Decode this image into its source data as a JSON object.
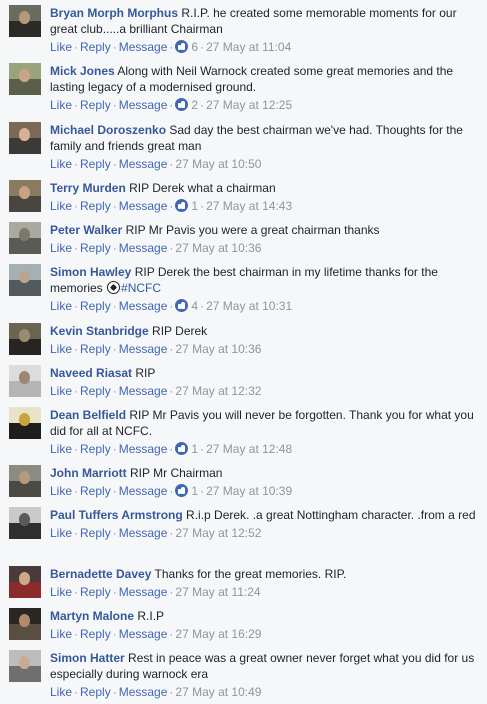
{
  "actions": {
    "like": "Like",
    "reply": "Reply",
    "message": "Message",
    "dot": "·"
  },
  "comments": [
    {
      "author": "Bryan Morph Morphus",
      "text": "R.I.P. he created some memorable moments for our great club.....a brilliant Chairman",
      "likes": "6",
      "time": "27 May at 11:04",
      "avatar_colors": [
        "#6b6b5e",
        "#2b2a24",
        "#b39a7c"
      ]
    },
    {
      "author": "Mick Jones",
      "text": "Along with Neil Warnock created some great memories and the lasting legacy of a modernised ground.",
      "likes": "2",
      "time": "27 May at 12:25",
      "avatar_colors": [
        "#9aa37a",
        "#5b5f4a",
        "#c9a488"
      ]
    },
    {
      "author": "Michael Doroszenko",
      "text": "Sad day the best chairman we've had. Thoughts for the family and friends great man",
      "likes": "",
      "time": "27 May at 10:50",
      "avatar_colors": [
        "#7a6a55",
        "#3b3a36",
        "#d6b193"
      ]
    },
    {
      "author": "Terry Murden",
      "text": "RIP Derek what a chairman",
      "likes": "1",
      "time": "27 May at 14:43",
      "avatar_colors": [
        "#8a7a62",
        "#4a463f",
        "#c7a383"
      ]
    },
    {
      "author": "Peter Walker",
      "text": "RIP Mr Pavis you were a great chairman thanks",
      "likes": "",
      "time": "27 May at 10:36",
      "avatar_colors": [
        "#a9a9a2",
        "#5c5a54",
        "#7d7869"
      ]
    },
    {
      "author": "Simon Hawley",
      "text": "RIP Derek the best chairman in my lifetime thanks for the memories",
      "hashtag": "#NCFC",
      "likes": "4",
      "time": "27 May at 10:31",
      "avatar_colors": [
        "#a4b0b5",
        "#53595c",
        "#b9a58e"
      ]
    },
    {
      "author": "Kevin Stanbridge",
      "text": "RIP Derek",
      "likes": "",
      "time": "27 May at 10:36",
      "avatar_colors": [
        "#6b6450",
        "#262523",
        "#9a8c70"
      ]
    },
    {
      "author": "Naveed Riasat",
      "text": "RIP",
      "likes": "",
      "time": "27 May at 12:32",
      "avatar_colors": [
        "#dcdcdc",
        "#b5b5b5",
        "#9e8672"
      ]
    },
    {
      "author": "Dean Belfield",
      "text": "RIP Mr Pavis you will never be forgotten. Thank you for what you did for all at NCFC.",
      "likes": "1",
      "time": "27 May at 12:48",
      "avatar_colors": [
        "#e8e2c8",
        "#1e1e1e",
        "#c8a43a"
      ]
    },
    {
      "author": "John Marriott",
      "text": "RIP Mr Chairman",
      "likes": "1",
      "time": "27 May at 10:39",
      "avatar_colors": [
        "#8c8b80",
        "#4b4a44",
        "#b69a80"
      ]
    },
    {
      "author": "Paul Tuffers Armstrong",
      "text": "R.i.p Derek. .a great Nottingham character. .from a red",
      "likes": "",
      "time": "27 May at 12:52",
      "avatar_colors": [
        "#c9c9c9",
        "#2f2f2f",
        "#5a5a5a"
      ]
    },
    {
      "author": "Bernadette Davey",
      "text": "Thanks for the great memories. RIP.",
      "likes": "",
      "time": "27 May at 11:24",
      "avatar_colors": [
        "#4a3b3a",
        "#8c2b2b",
        "#cfa98c"
      ]
    },
    {
      "author": "Martyn Malone",
      "text": "R.I.P",
      "likes": "",
      "time": "27 May at 16:29",
      "avatar_colors": [
        "#2a2622",
        "#5a4e40",
        "#b08a6a"
      ]
    },
    {
      "author": "Simon Hatter",
      "text": "Rest in peace was a great owner never forget what you did for us especially during warnock era",
      "likes": "",
      "time": "27 May at 10:49",
      "avatar_colors": [
        "#bdbdbd",
        "#6f6f6f",
        "#c9ab93"
      ]
    }
  ]
}
